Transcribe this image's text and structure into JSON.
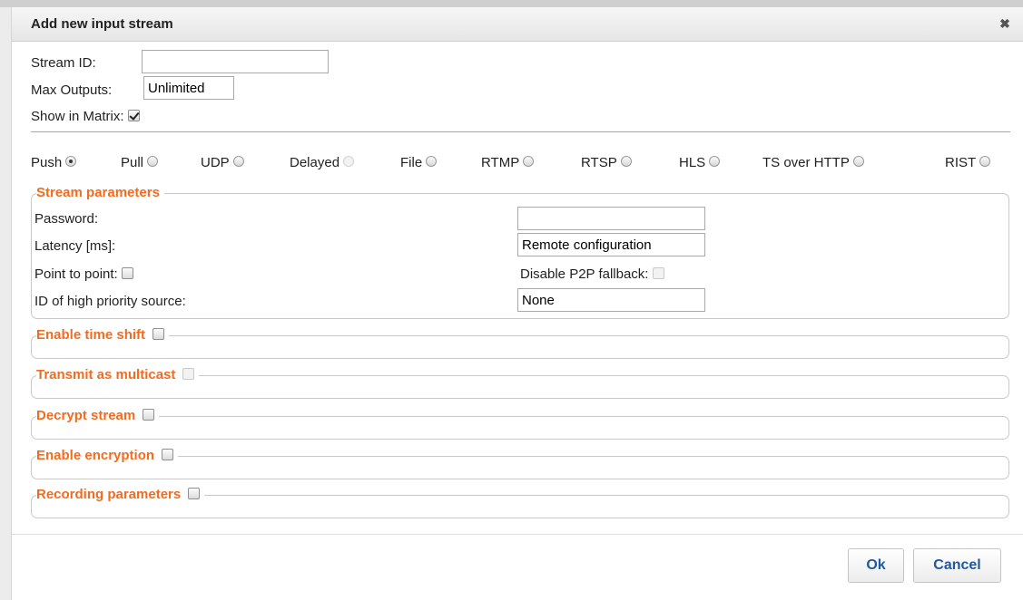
{
  "dialog": {
    "title": "Add new input stream",
    "close_icon": "close-icon"
  },
  "form": {
    "stream_id": {
      "label": "Stream ID:",
      "value": ""
    },
    "max_outputs": {
      "label": "Max Outputs:",
      "value": "Unlimited"
    },
    "show_in_matrix": {
      "label": "Show in Matrix:",
      "checked": true
    }
  },
  "stream_types": [
    {
      "label": "Push",
      "selected": true,
      "disabled": false
    },
    {
      "label": "Pull",
      "selected": false,
      "disabled": false
    },
    {
      "label": "UDP",
      "selected": false,
      "disabled": false
    },
    {
      "label": "Delayed",
      "selected": false,
      "disabled": true
    },
    {
      "label": "File",
      "selected": false,
      "disabled": false
    },
    {
      "label": "RTMP",
      "selected": false,
      "disabled": false
    },
    {
      "label": "RTSP",
      "selected": false,
      "disabled": false
    },
    {
      "label": "HLS",
      "selected": false,
      "disabled": false
    },
    {
      "label": "TS over HTTP",
      "selected": false,
      "disabled": false
    },
    {
      "label": "RIST",
      "selected": false,
      "disabled": false
    }
  ],
  "stream_parameters": {
    "legend": "Stream parameters",
    "password": {
      "label": "Password:",
      "value": ""
    },
    "latency": {
      "label": "Latency [ms]:",
      "value": "Remote configuration"
    },
    "point_to_point": {
      "label": "Point to point:",
      "checked": false
    },
    "disable_p2p_fallback": {
      "label": "Disable P2P fallback:",
      "checked": false,
      "disabled": true
    },
    "high_priority_source": {
      "label": "ID of high priority source:",
      "value": "None"
    }
  },
  "sections": {
    "time_shift": {
      "label": "Enable time shift",
      "checked": false
    },
    "multicast": {
      "label": "Transmit as multicast",
      "checked": false,
      "disabled": true
    },
    "decrypt": {
      "label": "Decrypt stream",
      "checked": false
    },
    "encryption": {
      "label": "Enable encryption",
      "checked": false
    },
    "recording": {
      "label": "Recording parameters",
      "checked": false
    }
  },
  "buttons": {
    "ok": "Ok",
    "cancel": "Cancel"
  },
  "colors": {
    "legend": "#f26b1f",
    "button_text": "#1c5aa6"
  }
}
